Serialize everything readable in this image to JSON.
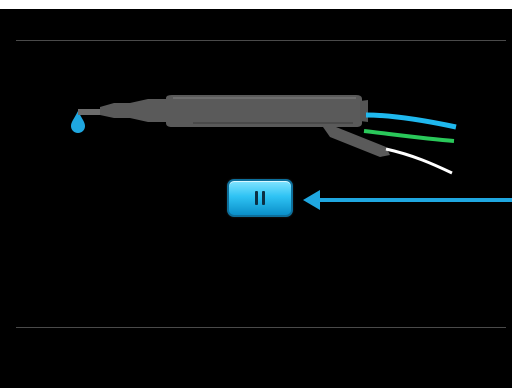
{
  "colors": {
    "screen_background": "#000000",
    "outer_frame": "#ffffff",
    "divider": "#4a4a4a",
    "handpiece_body": "#5a5a5a",
    "water_drop": "#1fa7e0",
    "cable_blue": "#1fb8ee",
    "cable_green": "#2ac85a",
    "cable_white": "#ffffff",
    "button_accent": "#2fc3f4",
    "arrow": "#1fa7e0"
  },
  "icons": {
    "handpiece": "scaler-handpiece-icon",
    "water_drop": "water-drop-icon",
    "pause": "pause-icon",
    "pointer": "left-arrow-icon"
  }
}
